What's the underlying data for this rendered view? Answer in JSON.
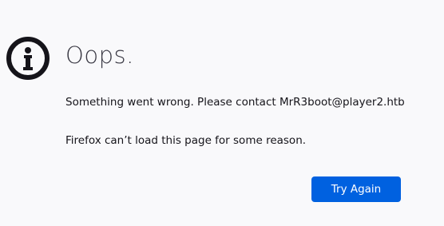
{
  "error_page": {
    "icon": "info-icon",
    "title": "Oops.",
    "message_primary": "Something went wrong. Please contact MrR3boot@player2.htb",
    "message_secondary": "Firefox can’t load this page for some reason.",
    "try_again_label": "Try Again"
  },
  "colors": {
    "background": "#f9f9fb",
    "text": "#15141a",
    "button": "#0061e0",
    "button_text": "#ffffff"
  }
}
